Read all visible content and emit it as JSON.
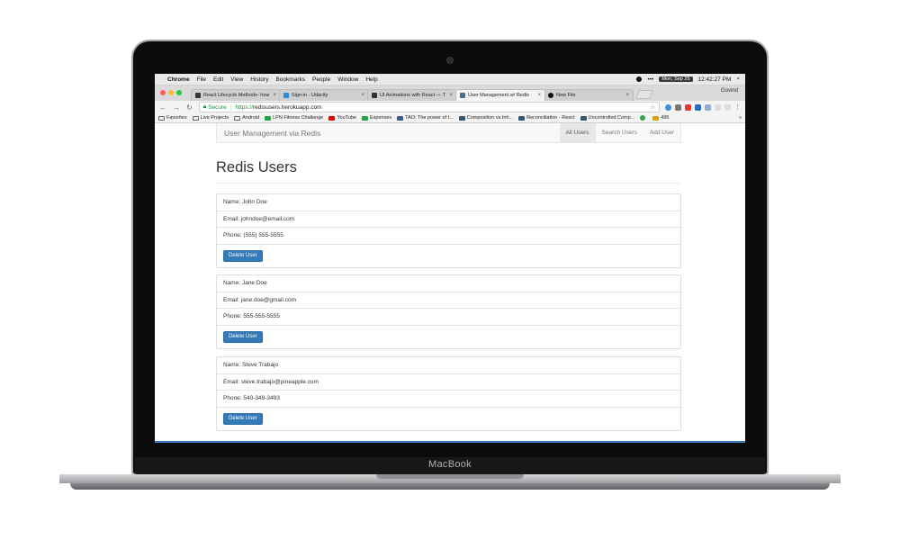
{
  "device": {
    "brand": "MacBook"
  },
  "mac_menubar": {
    "app": "Chrome",
    "items": [
      "File",
      "Edit",
      "View",
      "History",
      "Bookmarks",
      "People",
      "Window",
      "Help"
    ],
    "date": "Mon, Sep 25",
    "time": "12:42:27 PM"
  },
  "browser": {
    "profile": "Govind",
    "tabs": [
      {
        "label": "React Lifecycle Methods- how",
        "icon": "medium-icon"
      },
      {
        "label": "Sign-in - Udacity",
        "icon": "udacity-icon"
      },
      {
        "label": "UI Animations with React — T",
        "icon": "medium-icon"
      },
      {
        "label": "User Management w/ Redis",
        "icon": "redis-icon",
        "active": true
      },
      {
        "label": "New File",
        "icon": "github-icon"
      }
    ],
    "omnibox": {
      "secure": "Secure",
      "scheme": "https://",
      "host": "redisusers.herokuapp.com"
    },
    "bookmarks": [
      {
        "label": "Favorites",
        "icon": "folder"
      },
      {
        "label": "Live Projects",
        "icon": "folder"
      },
      {
        "label": "Android",
        "icon": "folder"
      },
      {
        "label": "LPN Fitness Challenge",
        "icon": "sheet"
      },
      {
        "label": "YouTube",
        "icon": "yt"
      },
      {
        "label": "Expenses",
        "icon": "sheet"
      },
      {
        "label": "TAO: The power of t...",
        "icon": "fb"
      },
      {
        "label": "Composition vs Inh...",
        "icon": "med"
      },
      {
        "label": "Reconciliation - React",
        "icon": "med"
      },
      {
        "label": "Uncontrolled Comp...",
        "icon": "med"
      },
      {
        "label": "",
        "icon": "chk"
      },
      {
        "label": "495",
        "icon": "num"
      }
    ],
    "bookmarks_more": "»"
  },
  "app": {
    "brand": "User Management via Redis",
    "nav": [
      "All Users",
      "Search Users",
      "Add User"
    ],
    "active_nav": "All Users",
    "title": "Redis Users",
    "delete_label": "Delete User",
    "users": [
      {
        "name": "Name: John Doe",
        "email": "Email: johndoe@email.com",
        "phone": "Phone: (555) 555-5555"
      },
      {
        "name": "Name: Jane Doe",
        "email": "Email: jane.doe@gmail.com",
        "phone": "Phone: 555-555-5555"
      },
      {
        "name": "Name: Steve Trabajo",
        "email": "Email: steve.trabajo@pineapple.com",
        "phone": "Phone: 540-349-3493"
      }
    ]
  },
  "colors": {
    "primary": "#337ab7",
    "navbar_bg": "#f8f8f8",
    "text": "#333333"
  }
}
